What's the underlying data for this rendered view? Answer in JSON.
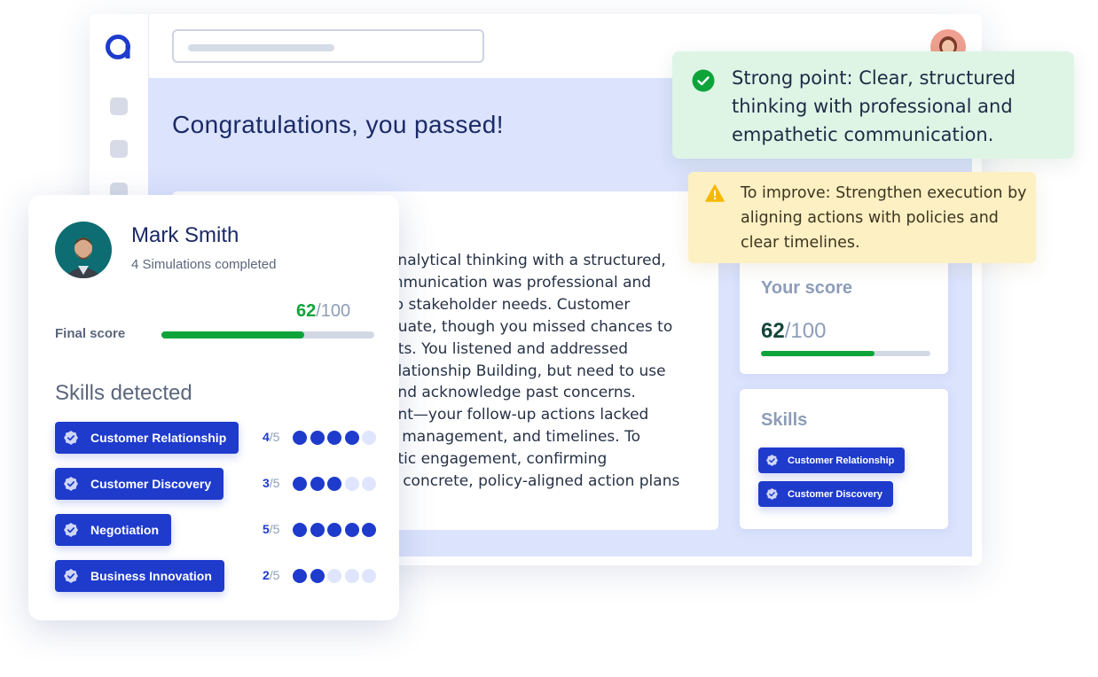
{
  "app": {
    "page_heading": "Congratulations, you passed!",
    "feedback_lines": [
      "analytical thinking with a structured,",
      "mmunication was professional and",
      "to stakeholder needs. Customer",
      "quate, though you missed chances to",
      "nts. You listened and addressed",
      "elationship Building, but need to use",
      "and acknowledge past concerns.",
      "ent—your follow-up actions lacked",
      "k management, and timelines. To",
      "etic engagement, confirming",
      "g concrete, policy-aligned action plans"
    ],
    "score_card": {
      "title": "Your score",
      "score": "62",
      "max": "/100",
      "progress": 0.67
    },
    "skills_card": {
      "title": "Skills",
      "skills": [
        "Customer Relationship",
        "Customer Discovery"
      ]
    }
  },
  "notes": {
    "strong": "Strong point: Clear, structured thinking with professional and empathetic communication.",
    "improve": "To improve: Strengthen execution by aligning actions with policies and clear timelines."
  },
  "profile": {
    "name": "Mark Smith",
    "subtitle": "4 Simulations completed",
    "score": "62",
    "max": "/100",
    "progress": 0.67,
    "final_label": "Final score",
    "skills_heading": "Skills detected",
    "skills": [
      {
        "label": "Customer Relationship",
        "score": "4",
        "max": "/5",
        "rating": 4
      },
      {
        "label": "Customer Discovery",
        "score": "3",
        "max": "/5",
        "rating": 3
      },
      {
        "label": "Negotiation",
        "score": "5",
        "max": "/5",
        "rating": 5
      },
      {
        "label": "Business Innovation",
        "score": "2",
        "max": "/5",
        "rating": 2
      }
    ]
  },
  "colors": {
    "brand": "#1e3bcc",
    "success": "#0ea43a",
    "strong_bg": "#def5e6",
    "improve_bg": "#fdf0c3",
    "content_bg": "#dbe3fd"
  },
  "icons": {
    "logo": "brand-logo-icon",
    "check": "check-circle-icon",
    "warning": "warning-triangle-icon",
    "badge": "verified-badge-icon"
  }
}
